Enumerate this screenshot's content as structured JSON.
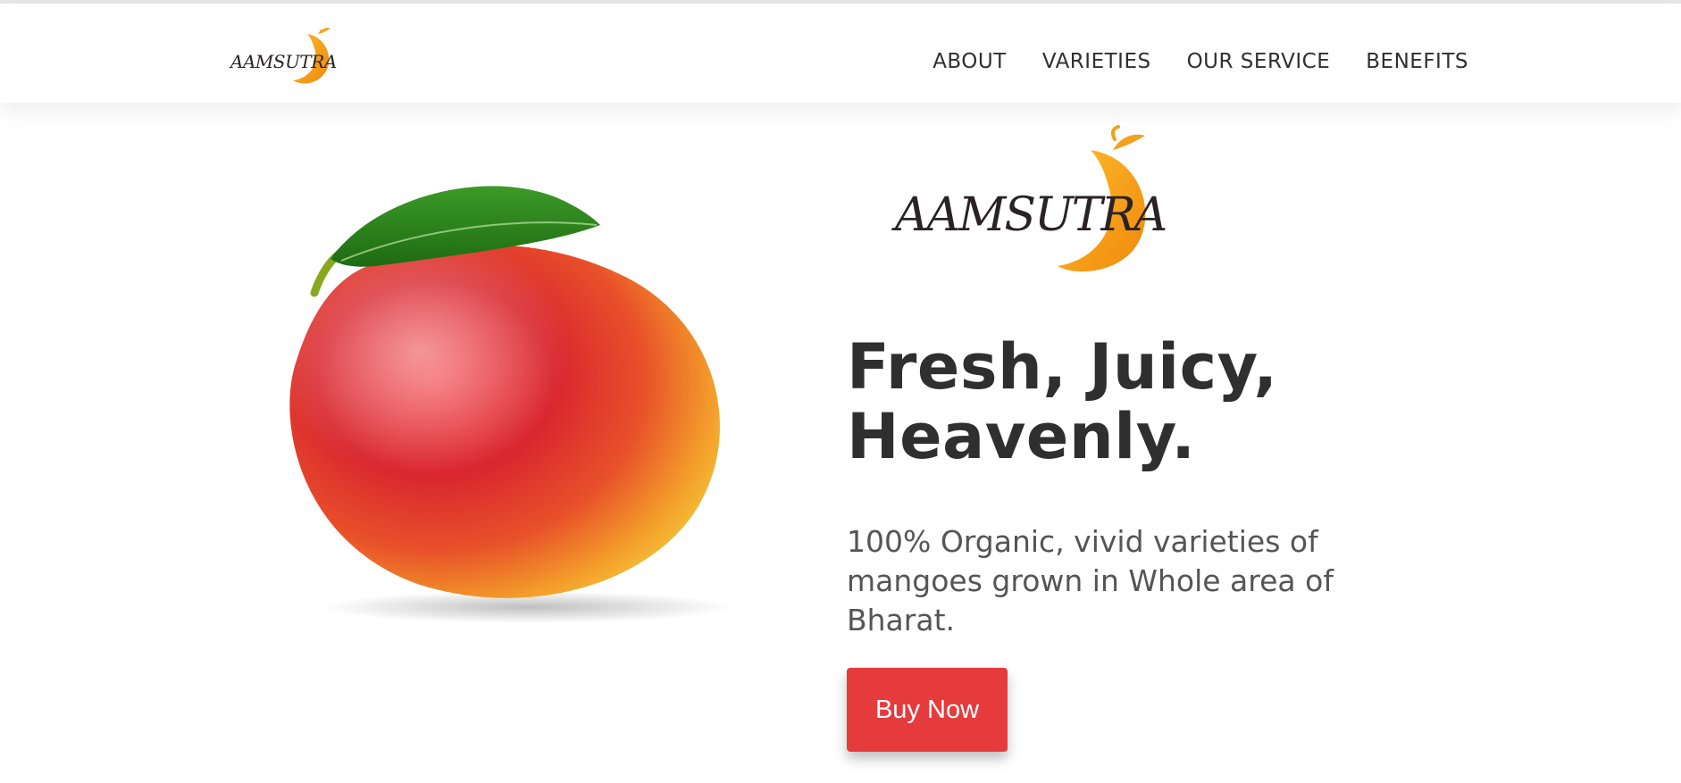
{
  "brand": {
    "name": "AAMSUTRA",
    "accent_color": "#f5a623",
    "leaf_color": "#f28c0f"
  },
  "nav": {
    "items": [
      {
        "label": "ABOUT"
      },
      {
        "label": "VARIETIES"
      },
      {
        "label": "OUR SERVICE"
      },
      {
        "label": "BENEFITS"
      }
    ]
  },
  "hero": {
    "image": "mango-with-leaf",
    "title": "Fresh, Juicy, Heavenly.",
    "subtitle": "100% Organic, vivid varieties of mangoes grown in Whole area of Bharat.",
    "cta_label": "Buy Now",
    "cta_color": "#e53b3d"
  }
}
